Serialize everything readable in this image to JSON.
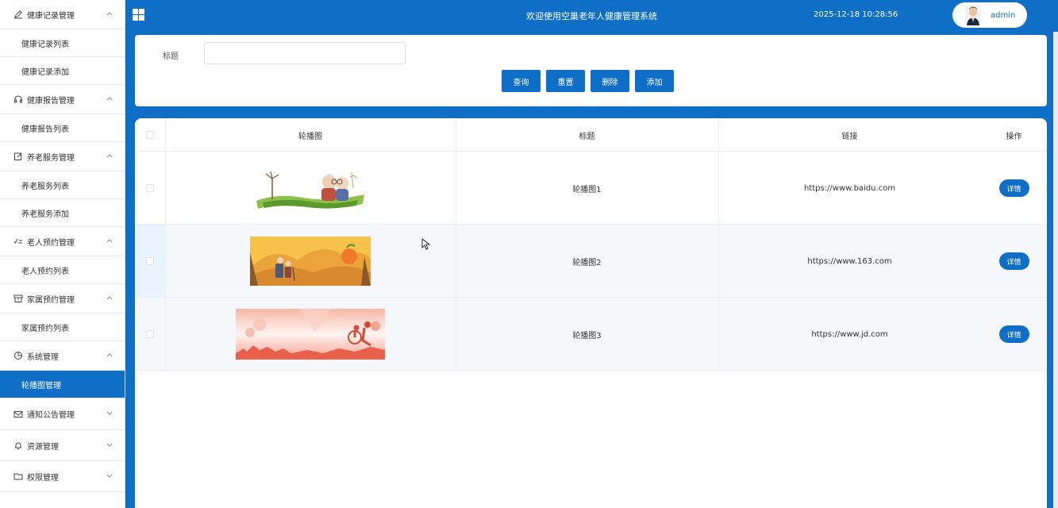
{
  "header": {
    "title": "欢迎使用空巢老年人健康管理系统",
    "datetime": "2025-12-18 10:28:56",
    "user": "admin"
  },
  "sidebar": {
    "items": [
      {
        "type": "group",
        "label": "健康记录管理",
        "icon": "pen-icon",
        "expanded": true
      },
      {
        "type": "sub",
        "label": "健康记录列表"
      },
      {
        "type": "sub",
        "label": "健康记录添加"
      },
      {
        "type": "group",
        "label": "健康报告管理",
        "icon": "headset-icon",
        "expanded": true
      },
      {
        "type": "sub",
        "label": "健康报告列表"
      },
      {
        "type": "group",
        "label": "养老服务管理",
        "icon": "edit-icon",
        "expanded": true
      },
      {
        "type": "sub",
        "label": "养老服务列表"
      },
      {
        "type": "sub",
        "label": "养老服务添加"
      },
      {
        "type": "group",
        "label": "老人预约管理",
        "icon": "checklist-icon",
        "expanded": true
      },
      {
        "type": "sub",
        "label": "老人预约列表"
      },
      {
        "type": "group",
        "label": "家属预约管理",
        "icon": "box-icon",
        "expanded": true
      },
      {
        "type": "sub",
        "label": "家属预约列表"
      },
      {
        "type": "group",
        "label": "系统管理",
        "icon": "pie-chart-icon",
        "expanded": true
      },
      {
        "type": "sub",
        "label": "轮播图管理",
        "active": true
      },
      {
        "type": "group",
        "label": "通知公告管理",
        "icon": "mail-icon",
        "expanded": false
      },
      {
        "type": "group",
        "label": "资源管理",
        "icon": "bell-icon",
        "expanded": false
      },
      {
        "type": "group",
        "label": "权限管理",
        "icon": "folder-icon",
        "expanded": false
      }
    ]
  },
  "search": {
    "label": "标题",
    "value": "",
    "buttons": [
      "查询",
      "重置",
      "删除",
      "添加"
    ]
  },
  "table": {
    "headers": [
      "轮播图",
      "标题",
      "链接",
      "操作"
    ],
    "rows": [
      {
        "title": "轮播图1",
        "link": "https://www.baidu.com",
        "action": "详情"
      },
      {
        "title": "轮播图2",
        "link": "https://www.163.com",
        "action": "详情"
      },
      {
        "title": "轮播图3",
        "link": "https://www.jd.com",
        "action": "详情"
      }
    ]
  },
  "colors": {
    "primary": "#0f6fc6",
    "row_highlight": "#f5f7fa"
  }
}
